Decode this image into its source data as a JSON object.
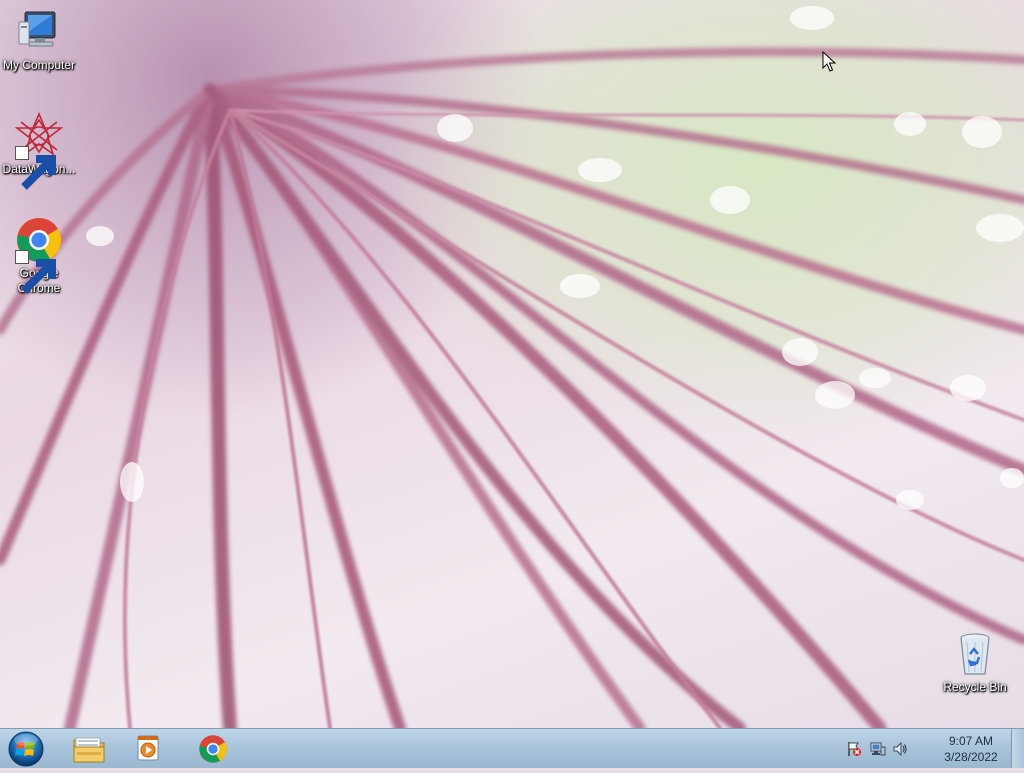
{
  "desktop": {
    "icons": [
      {
        "label": "My Computer",
        "icon": "computer-icon"
      },
      {
        "label": "DataWagon...",
        "icon": "datawagon-icon"
      },
      {
        "label": "Google Chrome",
        "icon": "chrome-icon"
      },
      {
        "label": "Recycle Bin",
        "icon": "recycle-bin-icon"
      }
    ]
  },
  "taskbar": {
    "start": {
      "icon": "windows-start-icon"
    },
    "pinned": [
      {
        "icon": "file-explorer-icon"
      },
      {
        "icon": "media-player-icon"
      },
      {
        "icon": "chrome-icon"
      }
    ],
    "tray": {
      "icons": [
        "action-center-flag-icon",
        "network-icon",
        "volume-icon"
      ],
      "time": "9:07 AM",
      "date": "3/28/2022"
    }
  },
  "colors": {
    "taskbar": "#a9c4db",
    "wallpaper_stem": "#a85a7a",
    "wallpaper_bg": "#ede2ea"
  }
}
